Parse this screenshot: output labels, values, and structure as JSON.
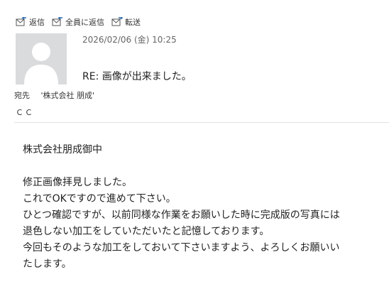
{
  "toolbar": {
    "reply_label": "返信",
    "reply_all_label": "全員に返信",
    "forward_label": "転送"
  },
  "header": {
    "datetime": "2026/02/06 (金) 10:25",
    "subject": "RE: 画像が出来ました。",
    "to_label": "宛先",
    "to_value": "'株式会社 朋成'",
    "cc_label": "ＣＣ"
  },
  "body": {
    "greeting": "株式会社朋成御中",
    "lines": [
      "修正画像拝見しました。",
      "これでOKですので進めて下さい。",
      "ひとつ確認ですが、以前同様な作業をお願いした時に完成版の写真には",
      "退色しない加工をしていただいたと記憶しております。",
      "今回もそのような加工をしておいて下さいますよう、よろしくお願いい",
      "たします。"
    ]
  },
  "colors": {
    "icon_accent": "#2b6cb0",
    "avatar_bg": "#d9dbdd",
    "avatar_fg": "#ffffff"
  }
}
